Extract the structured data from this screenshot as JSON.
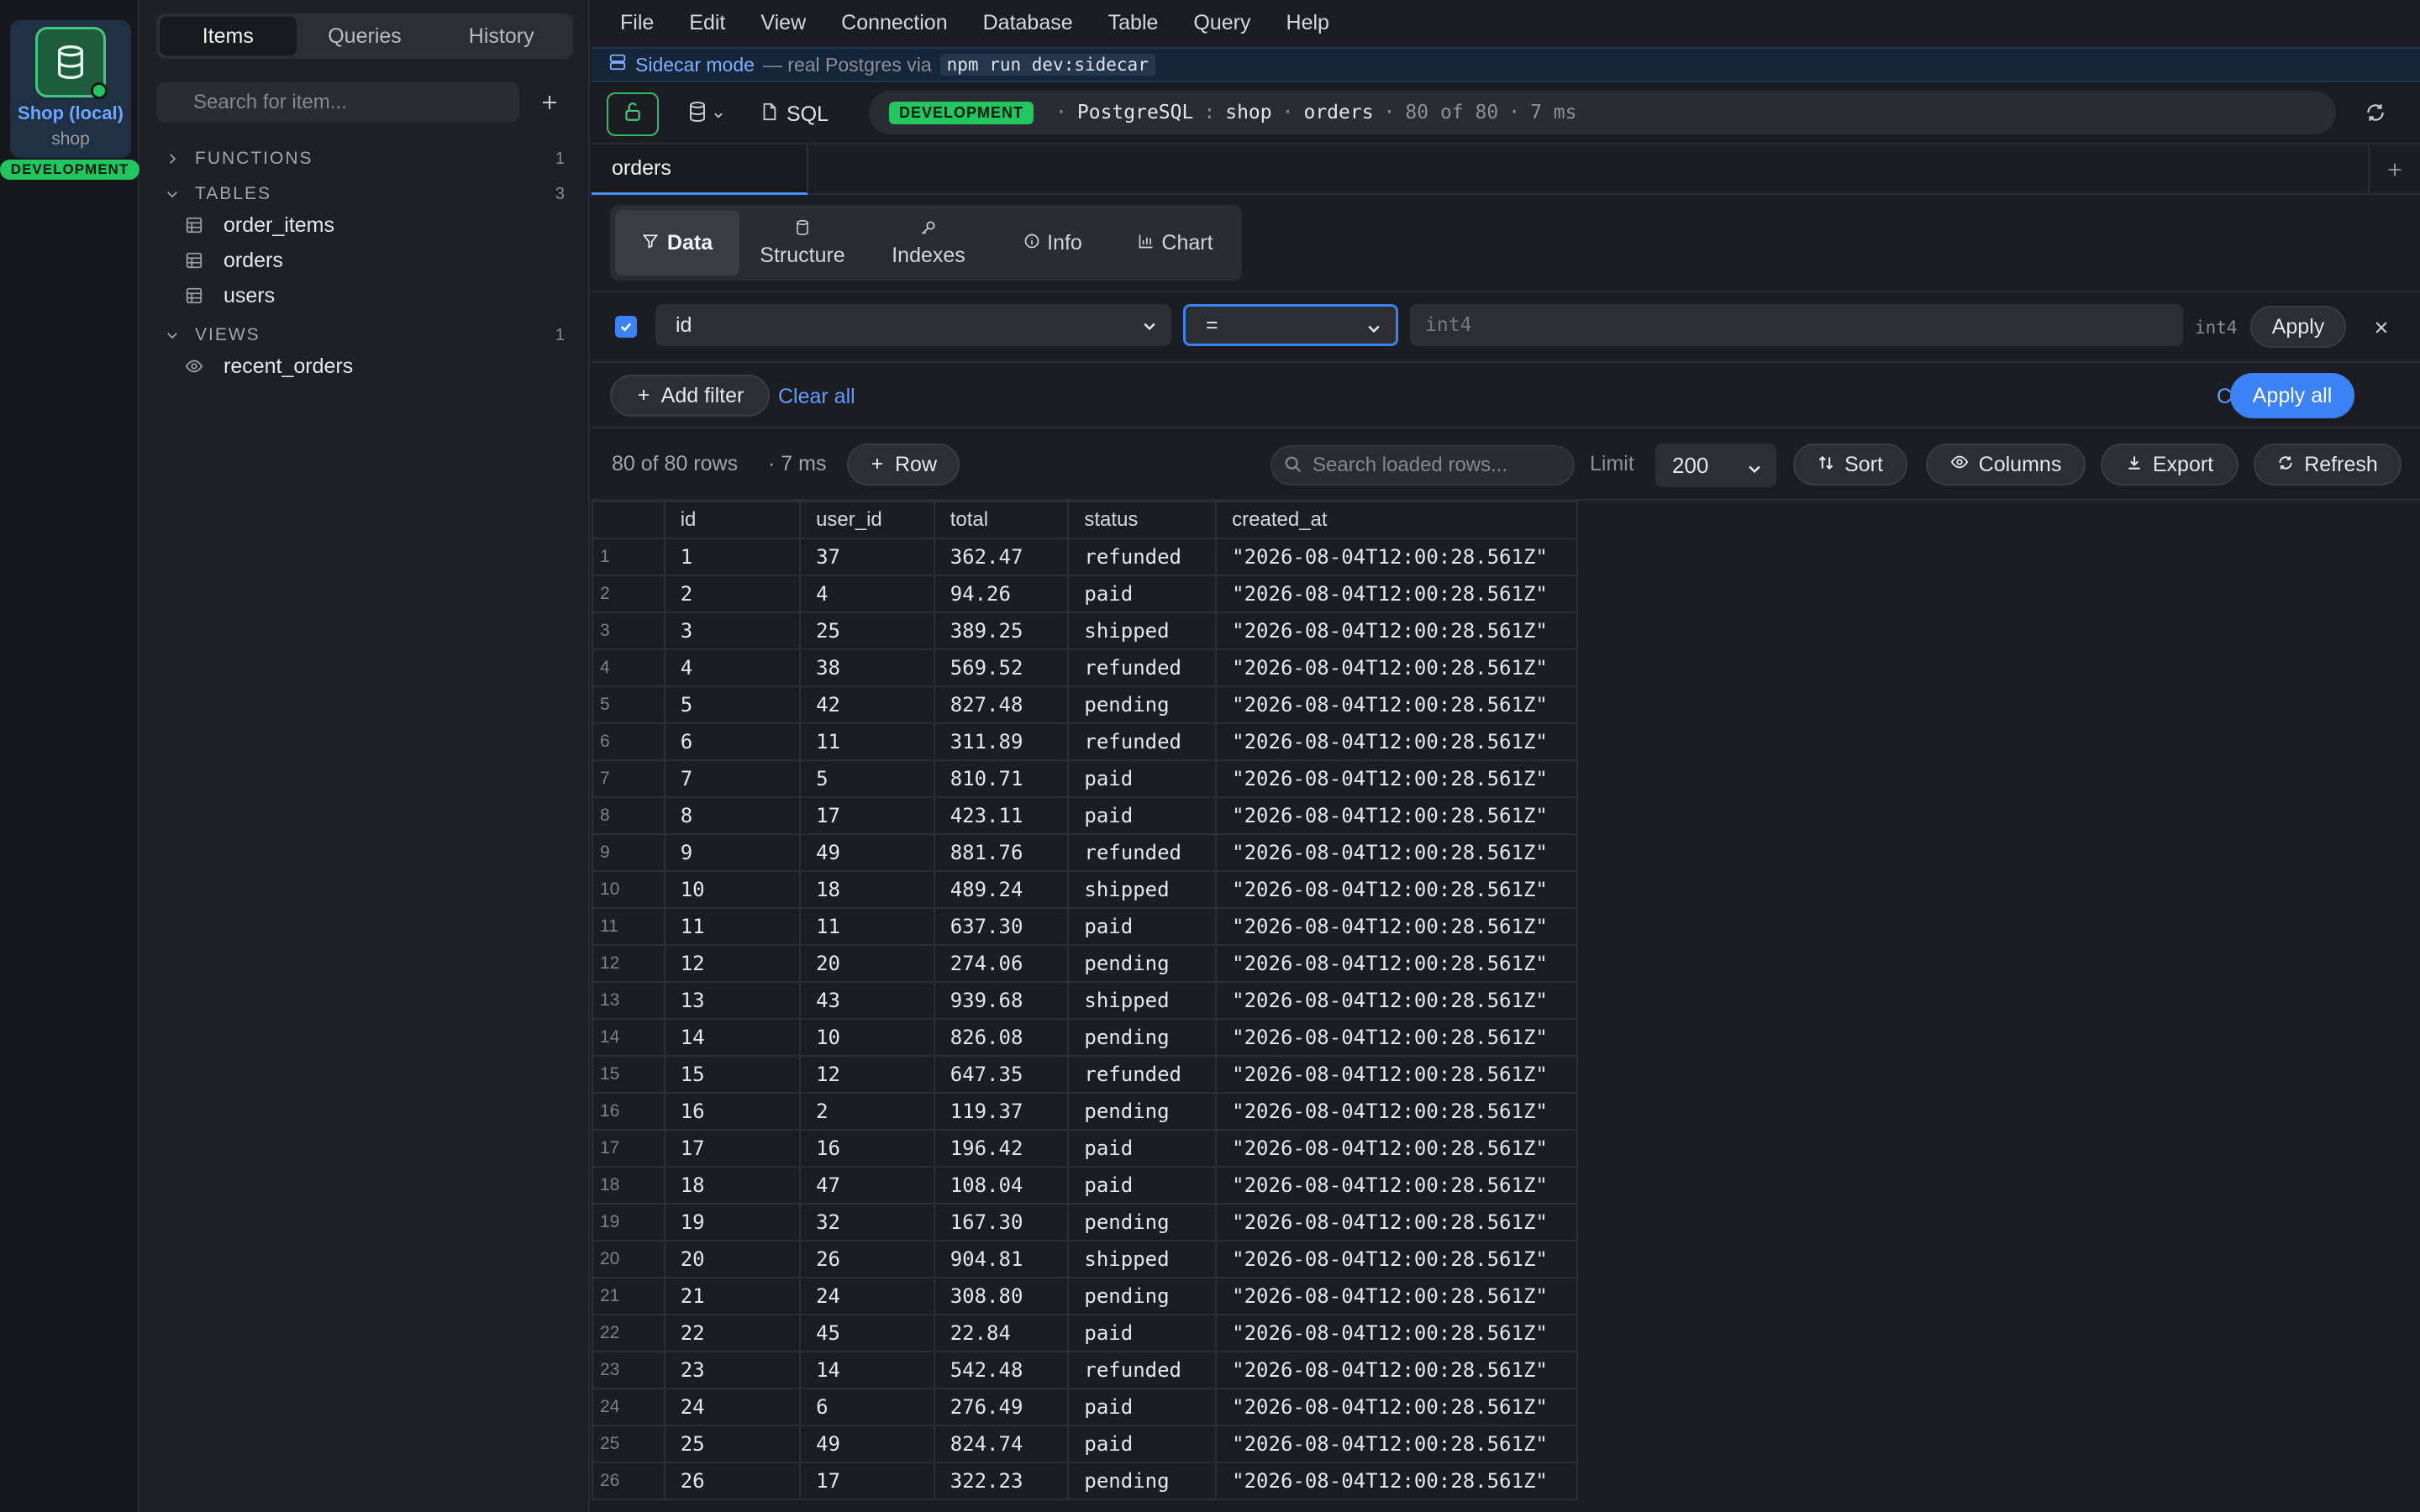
{
  "connection": {
    "name": "Shop (local)",
    "database": "shop",
    "env": "DEVELOPMENT"
  },
  "sidebar": {
    "tabs": [
      "Items",
      "Queries",
      "History"
    ],
    "search_placeholder": "Search for item...",
    "sections": [
      {
        "label": "FUNCTIONS",
        "count": "1"
      },
      {
        "label": "TABLES",
        "count": "3"
      },
      {
        "label": "VIEWS",
        "count": "1"
      }
    ],
    "tables": [
      "order_items",
      "orders",
      "users"
    ],
    "views": [
      "recent_orders"
    ]
  },
  "menu": [
    "File",
    "Edit",
    "View",
    "Connection",
    "Database",
    "Table",
    "Query",
    "Help"
  ],
  "banner": {
    "label": "Sidecar mode",
    "sub": "— real Postgres via",
    "code": "npm run dev:sidecar"
  },
  "toolbar": {
    "sql_label": "SQL",
    "env": "DEVELOPMENT",
    "engine": "PostgreSQL",
    "schema": "shop",
    "table": "orders",
    "count": "80 of 80",
    "time": "7 ms"
  },
  "tab": {
    "label": "orders"
  },
  "view_tabs": [
    "Data",
    "Structure",
    "Indexes",
    "Info",
    "Chart"
  ],
  "filter": {
    "column": "id",
    "operator": "=",
    "value_placeholder": "int4",
    "type": "int4",
    "apply_label": "Apply",
    "add_label": "Add filter",
    "clear_label": "Clear all",
    "close_label": "Close",
    "apply_all_label": "Apply all"
  },
  "grid_toolbar": {
    "summary": "80 of 80 rows",
    "time": "· 7 ms",
    "row_label": "Row",
    "search_placeholder": "Search loaded rows...",
    "limit_label": "Limit",
    "limit_value": "200",
    "sort_label": "Sort",
    "columns_label": "Columns",
    "export_label": "Export",
    "refresh_label": "Refresh"
  },
  "columns": [
    "id",
    "user_id",
    "total",
    "status",
    "created_at"
  ],
  "rows": [
    [
      "1",
      "1",
      "37",
      "362.47",
      "refunded",
      "\"2026-08-04T12:00:28.561Z\""
    ],
    [
      "2",
      "2",
      "4",
      "94.26",
      "paid",
      "\"2026-08-04T12:00:28.561Z\""
    ],
    [
      "3",
      "3",
      "25",
      "389.25",
      "shipped",
      "\"2026-08-04T12:00:28.561Z\""
    ],
    [
      "4",
      "4",
      "38",
      "569.52",
      "refunded",
      "\"2026-08-04T12:00:28.561Z\""
    ],
    [
      "5",
      "5",
      "42",
      "827.48",
      "pending",
      "\"2026-08-04T12:00:28.561Z\""
    ],
    [
      "6",
      "6",
      "11",
      "311.89",
      "refunded",
      "\"2026-08-04T12:00:28.561Z\""
    ],
    [
      "7",
      "7",
      "5",
      "810.71",
      "paid",
      "\"2026-08-04T12:00:28.561Z\""
    ],
    [
      "8",
      "8",
      "17",
      "423.11",
      "paid",
      "\"2026-08-04T12:00:28.561Z\""
    ],
    [
      "9",
      "9",
      "49",
      "881.76",
      "refunded",
      "\"2026-08-04T12:00:28.561Z\""
    ],
    [
      "10",
      "10",
      "18",
      "489.24",
      "shipped",
      "\"2026-08-04T12:00:28.561Z\""
    ],
    [
      "11",
      "11",
      "11",
      "637.30",
      "paid",
      "\"2026-08-04T12:00:28.561Z\""
    ],
    [
      "12",
      "12",
      "20",
      "274.06",
      "pending",
      "\"2026-08-04T12:00:28.561Z\""
    ],
    [
      "13",
      "13",
      "43",
      "939.68",
      "shipped",
      "\"2026-08-04T12:00:28.561Z\""
    ],
    [
      "14",
      "14",
      "10",
      "826.08",
      "pending",
      "\"2026-08-04T12:00:28.561Z\""
    ],
    [
      "15",
      "15",
      "12",
      "647.35",
      "refunded",
      "\"2026-08-04T12:00:28.561Z\""
    ],
    [
      "16",
      "16",
      "2",
      "119.37",
      "pending",
      "\"2026-08-04T12:00:28.561Z\""
    ],
    [
      "17",
      "17",
      "16",
      "196.42",
      "paid",
      "\"2026-08-04T12:00:28.561Z\""
    ],
    [
      "18",
      "18",
      "47",
      "108.04",
      "paid",
      "\"2026-08-04T12:00:28.561Z\""
    ],
    [
      "19",
      "19",
      "32",
      "167.30",
      "pending",
      "\"2026-08-04T12:00:28.561Z\""
    ],
    [
      "20",
      "20",
      "26",
      "904.81",
      "shipped",
      "\"2026-08-04T12:00:28.561Z\""
    ],
    [
      "21",
      "21",
      "24",
      "308.80",
      "pending",
      "\"2026-08-04T12:00:28.561Z\""
    ],
    [
      "22",
      "22",
      "45",
      "22.84",
      "paid",
      "\"2026-08-04T12:00:28.561Z\""
    ],
    [
      "23",
      "23",
      "14",
      "542.48",
      "refunded",
      "\"2026-08-04T12:00:28.561Z\""
    ],
    [
      "24",
      "24",
      "6",
      "276.49",
      "paid",
      "\"2026-08-04T12:00:28.561Z\""
    ],
    [
      "25",
      "25",
      "49",
      "824.74",
      "paid",
      "\"2026-08-04T12:00:28.561Z\""
    ],
    [
      "26",
      "26",
      "17",
      "322.23",
      "pending",
      "\"2026-08-04T12:00:28.561Z\""
    ]
  ],
  "colors": {
    "accent": "#3b82f6",
    "env": "#22c55e"
  }
}
